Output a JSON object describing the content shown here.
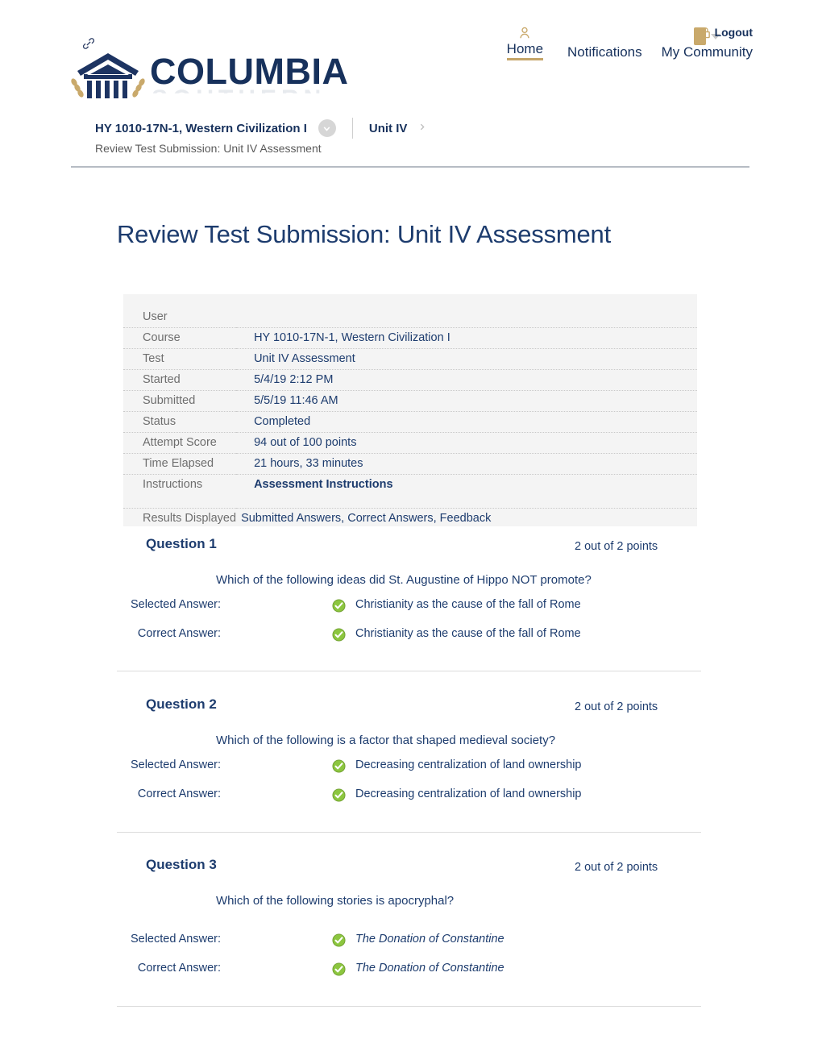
{
  "header": {
    "link_icon": "link-icon",
    "logo": {
      "line1": "COLUMBIA",
      "line2": "SOUTHERN"
    },
    "nav": [
      {
        "label": "Home",
        "icon": "person-icon",
        "active": true
      },
      {
        "label": "Notifications",
        "icon": "",
        "active": false
      },
      {
        "label": "My Community",
        "icon": "community-swatch",
        "active": false
      }
    ],
    "logout": {
      "label": "Logout",
      "icon": "lock-icon"
    }
  },
  "breadcrumb": {
    "course": "HY 1010-17N-1, Western Civilization I",
    "course_menu_icon": "chevron-down-icon",
    "unit": "Unit IV",
    "unit_arrow_icon": "chevron-right-icon",
    "subtitle": "Review Test Submission: Unit IV Assessment"
  },
  "page_title": "Review Test Submission: Unit IV Assessment",
  "info": {
    "rows": [
      {
        "label": "User",
        "value": ""
      },
      {
        "label": "Course",
        "value": "HY 1010-17N-1, Western Civilization I"
      },
      {
        "label": "Test",
        "value": "Unit IV Assessment"
      },
      {
        "label": "Started",
        "value": "5/4/19 2:12 PM"
      },
      {
        "label": "Submitted",
        "value": "5/5/19 11:46 AM"
      },
      {
        "label": "Status",
        "value": "Completed"
      },
      {
        "label": "Attempt Score",
        "value": "94 out of 100 points"
      },
      {
        "label": "Time Elapsed",
        "value": "21 hours, 33 minutes"
      },
      {
        "label": "Instructions",
        "value": "Assessment Instructions",
        "bold": true
      }
    ],
    "results_displayed": {
      "label": "Results Displayed",
      "value": "Submitted Answers, Correct Answers, Feedback"
    }
  },
  "questions": [
    {
      "title": "Question 1",
      "points": "2 out of 2 points",
      "text": "Which of the following ideas did St. Augustine of Hippo NOT promote?",
      "selected_label": "Selected Answer:",
      "selected_value": "Christianity as the cause of the fall of Rome",
      "selected_status_icon": "correct-check-icon",
      "correct_label": "Correct Answer:",
      "correct_value": "Christianity as the cause of the fall of Rome",
      "correct_status_icon": "correct-check-icon",
      "italic": false
    },
    {
      "title": "Question 2",
      "points": "2 out of 2 points",
      "text": "Which of the following is a factor that shaped medieval society?",
      "selected_label": "Selected Answer:",
      "selected_value": "Decreasing centralization of land ownership",
      "selected_status_icon": "correct-check-icon",
      "correct_label": "Correct Answer:",
      "correct_value": "Decreasing centralization of land ownership",
      "correct_status_icon": "correct-check-icon",
      "italic": false
    },
    {
      "title": "Question 3",
      "points": "2 out of 2 points",
      "text": "Which of the following stories is apocryphal?",
      "selected_label": "Selected Answer:",
      "selected_value": "The Donation of Constantine",
      "selected_status_icon": "correct-check-icon",
      "correct_label": "Correct Answer:",
      "correct_value": "The Donation of Constantine",
      "correct_status_icon": "correct-check-icon",
      "italic": true
    }
  ],
  "colors": {
    "brand_navy": "#17315c",
    "link_navy": "#1d3c6e",
    "accent_gold": "#c9a96b",
    "correct_green": "#7cb425",
    "panel_bg": "#f4f4f4"
  }
}
